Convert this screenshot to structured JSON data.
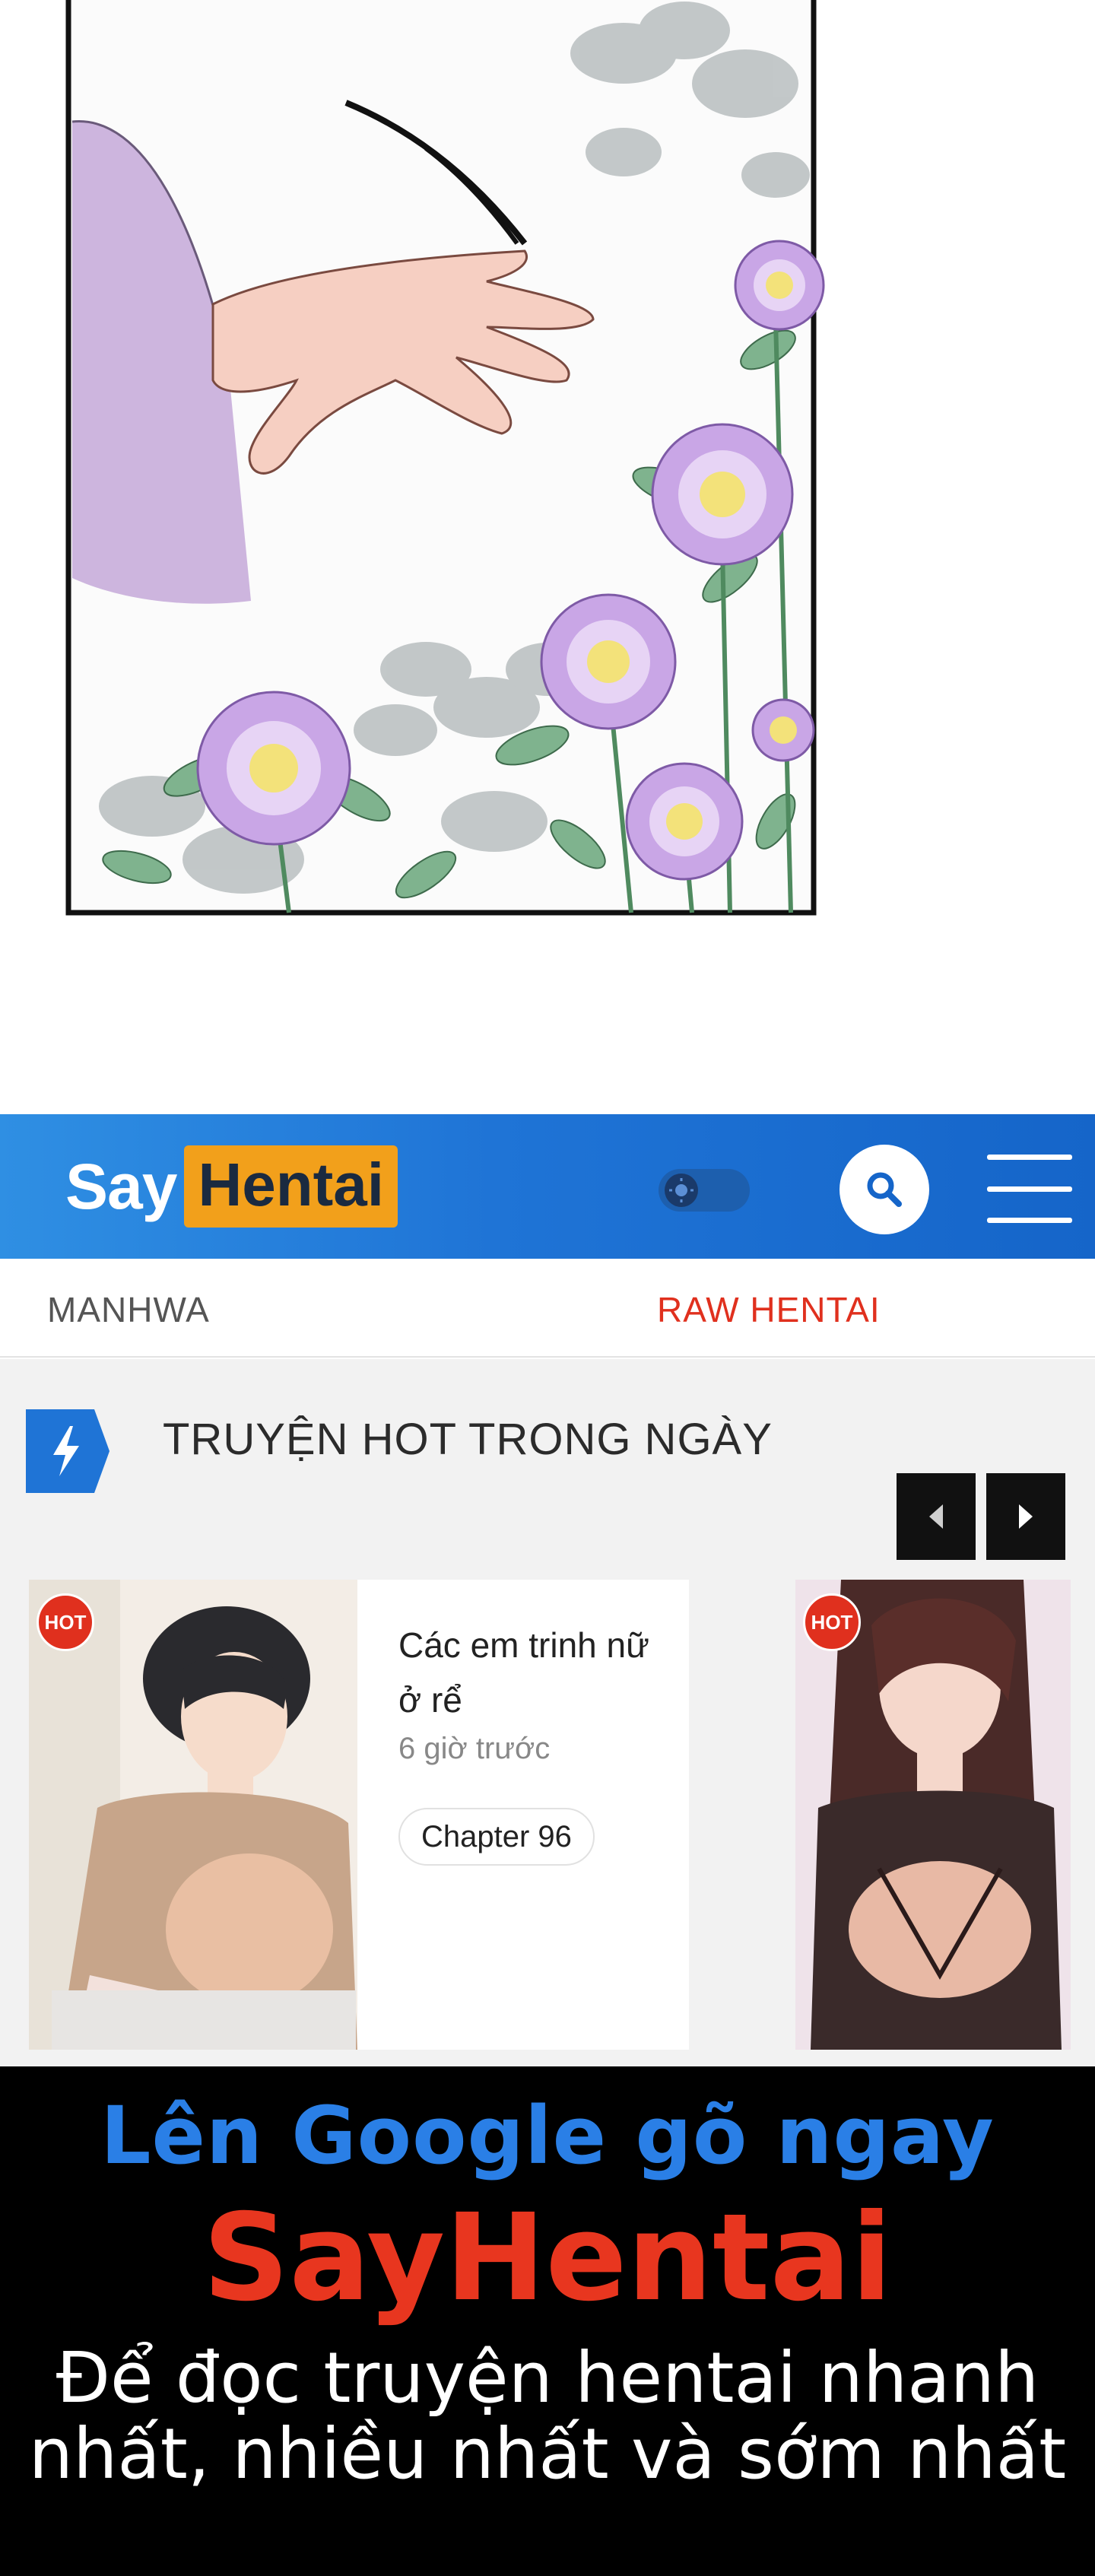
{
  "header": {
    "logo_left": "Say",
    "logo_right": "Hentai"
  },
  "nav": {
    "tabs": [
      {
        "label": "MANHWA"
      },
      {
        "label": "RAW HENTAI"
      }
    ]
  },
  "hot_section": {
    "title": "TRUYỆN HOT TRONG NGÀY",
    "cards": [
      {
        "badge": "HOT",
        "title": "Các em trinh nữ ở rể",
        "time": "6 giờ trước",
        "chapter": "Chapter 96"
      },
      {
        "badge": "HOT"
      }
    ]
  },
  "promo": {
    "line1": "Lên Google gõ ngay",
    "line2": "SayHentai",
    "line3": "Để đọc truyện hentai nhanh nhất, nhiều nhất và sớm nhất"
  },
  "colors": {
    "header_blue": "#1f74d6",
    "logo_accent": "#f2a01b",
    "hot_red": "#e0301e",
    "promo_blue": "#2a7fe6",
    "promo_red": "#e8361f"
  },
  "icons": [
    "lightning-icon",
    "search-icon",
    "hamburger-menu-icon",
    "chevron-left-icon",
    "chevron-right-icon",
    "sun-icon"
  ]
}
